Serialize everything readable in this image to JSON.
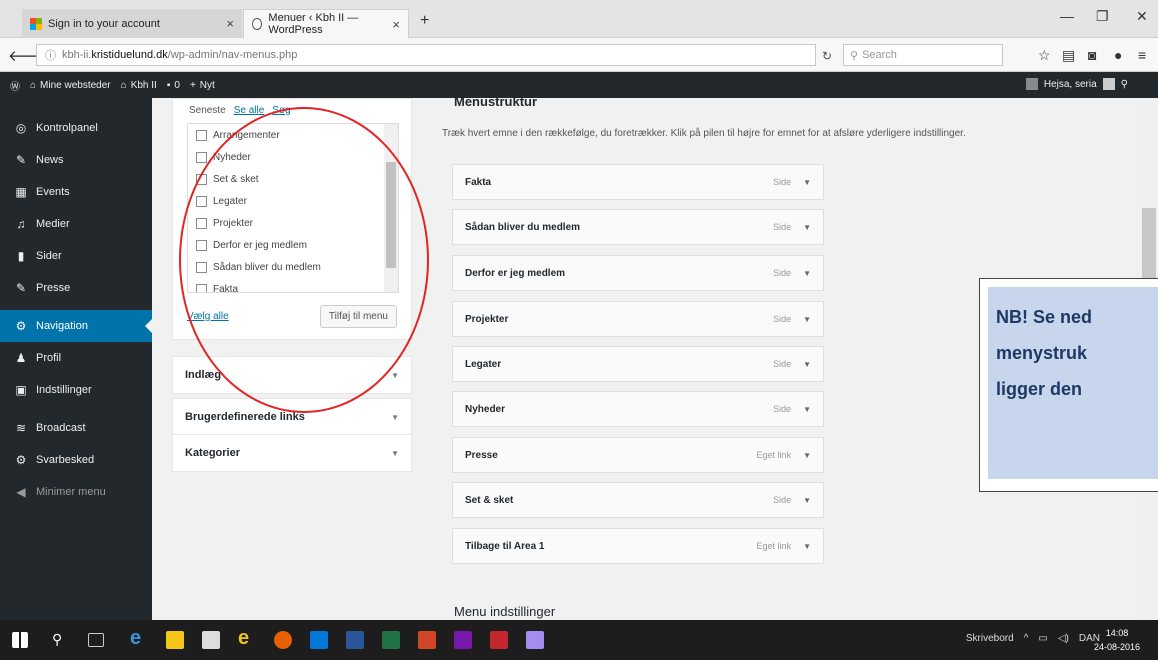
{
  "browser": {
    "tabs": [
      {
        "title": "Sign in to your account"
      },
      {
        "title": "Menuer ‹ Kbh II — WordPress"
      }
    ],
    "url_prefix": "kbh-ii.",
    "url_domain": "kristiduelund.dk",
    "url_path": "/wp-admin/nav-menus.php",
    "search_placeholder": "Search"
  },
  "adminbar": {
    "sites": "Mine websteder",
    "site": "Kbh II",
    "comments": "0",
    "new": "Nyt",
    "greeting": "Hejsa, seria"
  },
  "sidebar": {
    "items": [
      {
        "label": "Kontrolpanel",
        "icon": "dashboard-icon"
      },
      {
        "label": "News",
        "icon": "pin-icon"
      },
      {
        "label": "Events",
        "icon": "calendar-icon"
      },
      {
        "label": "Medier",
        "icon": "media-icon"
      },
      {
        "label": "Sider",
        "icon": "pages-icon"
      },
      {
        "label": "Presse",
        "icon": "pin-icon"
      },
      {
        "label": "Navigation",
        "icon": "gear-icon"
      },
      {
        "label": "Profil",
        "icon": "user-icon"
      },
      {
        "label": "Indstillinger",
        "icon": "settings-icon"
      },
      {
        "label": "Broadcast",
        "icon": "wifi-icon"
      },
      {
        "label": "Svarbesked",
        "icon": "gear-icon"
      },
      {
        "label": "Minimer menu",
        "icon": "collapse-icon"
      }
    ]
  },
  "pages_panel": {
    "tabs": [
      "Seneste",
      "Se alle",
      "Søg"
    ],
    "items": [
      "Arrangementer",
      "Nyheder",
      "Set & sket",
      "Legater",
      "Projekter",
      "Derfor er jeg medlem",
      "Sådan bliver du medlem",
      "Fakta"
    ],
    "select_all": "Vælg alle",
    "add_button": "Tilføj til menu"
  },
  "accordions": [
    "Indlæg",
    "Brugerdefinerede links",
    "Kategorier"
  ],
  "menu_structure": {
    "heading": "Menustruktur",
    "description": "Træk hvert emne i den rækkefølge, du foretrækker. Klik på pilen til højre for emnet for at afsløre yderligere indstillinger.",
    "items": [
      {
        "title": "Fakta",
        "type": "Side"
      },
      {
        "title": "Sådan bliver du medlem",
        "type": "Side"
      },
      {
        "title": "Derfor er jeg medlem",
        "type": "Side"
      },
      {
        "title": "Projekter",
        "type": "Side"
      },
      {
        "title": "Legater",
        "type": "Side"
      },
      {
        "title": "Nyheder",
        "type": "Side"
      },
      {
        "title": "Presse",
        "type": "Eget link"
      },
      {
        "title": "Set & sket",
        "type": "Side"
      },
      {
        "title": "Tilbage til Area 1",
        "type": "Eget link"
      }
    ],
    "settings_heading": "Menu indstillinger"
  },
  "note": {
    "lines": [
      "NB! Se ned",
      "menystruk",
      "ligger den"
    ]
  },
  "taskbar": {
    "tray_label": "Skrivebord",
    "lang": "DAN",
    "time": "14:08",
    "date": "24-08-2016"
  },
  "colors": {
    "wp_admin_dark": "#23282d",
    "wp_blue": "#0073aa",
    "annotation_red": "#e32424",
    "note_fill": "#c7d6ec"
  }
}
